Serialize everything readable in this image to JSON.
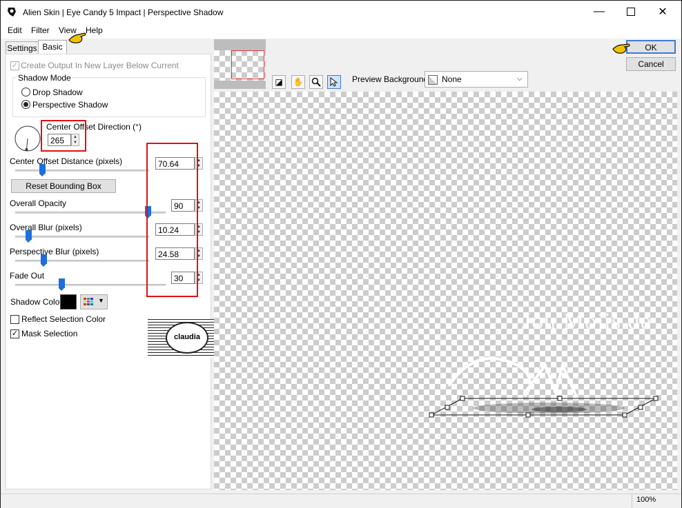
{
  "window": {
    "title": "Alien Skin | Eye Candy 5 Impact | Perspective Shadow"
  },
  "menu": {
    "items": [
      "Edit",
      "Filter",
      "View",
      "Help"
    ]
  },
  "tabs": {
    "settings": "Settings",
    "basic": "Basic"
  },
  "basic": {
    "create_output_label": "Create Output In New Layer Below Current",
    "shadow_mode_label": "Shadow Mode",
    "drop_shadow_label": "Drop Shadow",
    "perspective_shadow_label": "Perspective Shadow",
    "selected_mode": "Perspective Shadow",
    "center_offset_direction_label": "Center Offset Direction (°)",
    "center_offset_direction_value": "265",
    "center_offset_distance_label": "Center Offset Distance (pixels)",
    "center_offset_distance_value": "70.64",
    "reset_bounding_box_label": "Reset Bounding Box",
    "overall_opacity_label": "Overall Opacity",
    "overall_opacity_value": "90",
    "overall_blur_label": "Overall Blur (pixels)",
    "overall_blur_value": "10.24",
    "perspective_blur_label": "Perspective Blur (pixels)",
    "perspective_blur_value": "24.58",
    "fade_out_label": "Fade Out",
    "fade_out_value": "30",
    "shadow_color_label": "Shadow Color",
    "shadow_color": "#000000",
    "reflect_selection_color_label": "Reflect Selection Color",
    "reflect_selection_color_checked": false,
    "mask_selection_label": "Mask Selection",
    "mask_selection_checked": true
  },
  "watermark": {
    "text": "claudia"
  },
  "preview": {
    "background_label": "Preview Background:",
    "background_value": "None",
    "watermark_text": "Jou Mojis.de"
  },
  "buttons": {
    "ok": "OK",
    "cancel": "Cancel"
  },
  "status": {
    "zoom": "100%"
  },
  "colors": {
    "highlight_red": "#e01010",
    "slider_blue": "#1e6fd9",
    "hand_pointer": "#f2c200"
  }
}
